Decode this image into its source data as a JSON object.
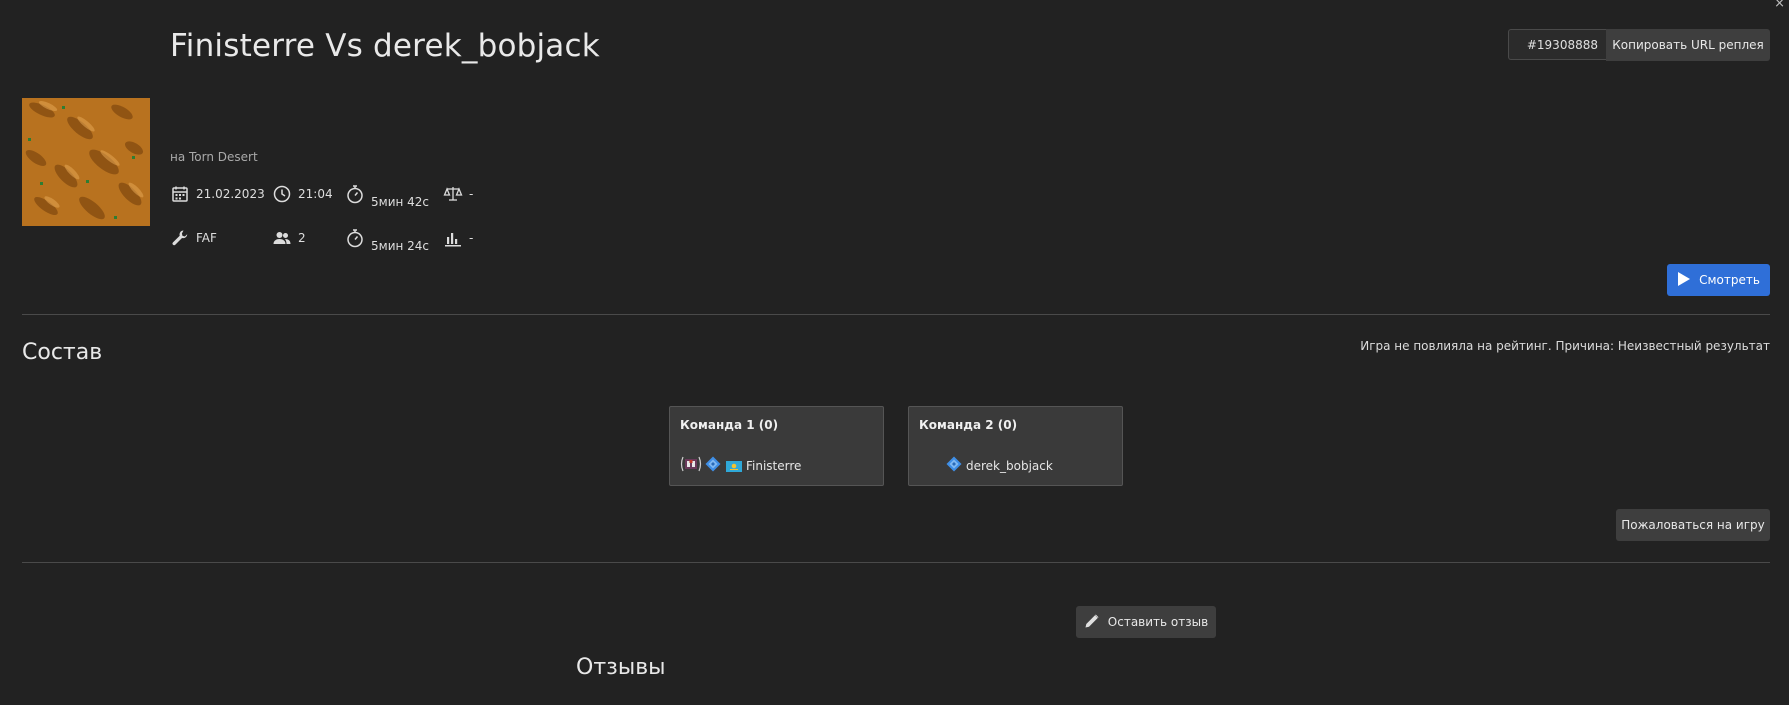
{
  "window": {
    "close_glyph": "×"
  },
  "header": {
    "title": "Finisterre Vs derek_bobjack",
    "replay_id": "#19308888",
    "copy_url_label": "Копировать URL реплея"
  },
  "map": {
    "name_line": "на Torn Desert",
    "preview_icon": "map-preview"
  },
  "info": {
    "date": "21.02.2023",
    "time": "21:04",
    "duration_1": "5мин 42с",
    "balance": "-",
    "featured_mod": "FAF",
    "player_count": "2",
    "duration_2": "5мин 24с",
    "rating": "-",
    "icons": {
      "date": "calendar-icon",
      "time": "clock-icon",
      "duration_1": "stopwatch-icon",
      "balance": "scales-icon",
      "featured_mod": "wrench-icon",
      "player_count": "people-icon",
      "duration_2": "stopwatch-icon",
      "rating": "bar-chart-icon"
    }
  },
  "actions": {
    "watch_label": "Смотреть",
    "report_label": "Пожаловаться на игру",
    "review_label": "Оставить отзыв"
  },
  "teams_section": {
    "title": "Состав",
    "rating_note": "Игра не повлияла на рейтинг. Причина: Неизвестный результат",
    "teams": [
      {
        "name": "Команда 1 (0)",
        "players": [
          {
            "name": "Finisterre",
            "has_avatar": true,
            "has_flag": true
          }
        ]
      },
      {
        "name": "Команда 2 (0)",
        "players": [
          {
            "name": "derek_bobjack",
            "has_avatar": false,
            "has_flag": false
          }
        ]
      }
    ]
  },
  "reviews": {
    "title": "Отзывы"
  },
  "colors": {
    "background": "#222222",
    "accent": "#2f6fd8",
    "button": "#3e3e3e",
    "card": "#3a3a3a",
    "divider": "#4a4a4a",
    "rank_icon": "#3e8ee6"
  }
}
